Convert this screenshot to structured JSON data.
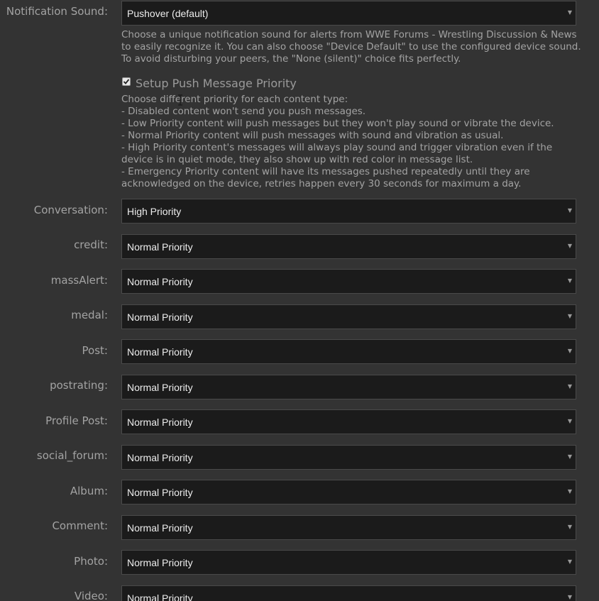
{
  "notification_sound": {
    "label": "Notification Sound:",
    "value": "Pushover (default)",
    "help_lines": [
      "Choose a unique notification sound for alerts from WWE Forums - Wrestling Discussion & News",
      "to easily recognize it. You can also choose \"Device Default\" to use the configured device sound.",
      "To avoid disturbing your peers, the \"None (silent)\" choice fits perfectly."
    ]
  },
  "priority_setup": {
    "checkbox_label": "Setup Push Message Priority",
    "checked": true,
    "help_lines": [
      "Choose different priority for each content type:",
      "- Disabled content won't send you push messages.",
      "- Low Priority content will push messages but they won't play sound or vibrate the device.",
      "- Normal Priority content will push messages with sound and vibration as usual.",
      "- High Priority content's messages will always play sound and trigger vibration even if the",
      "device is in quiet mode, they also show up with red color in message list.",
      "- Emergency Priority content will have its messages pushed repeatedly until they are",
      "acknowledged on the device, retries happen every 30 seconds for maximum a day."
    ]
  },
  "content_types": [
    {
      "label": "Conversation:",
      "value": "High Priority"
    },
    {
      "label": "credit:",
      "value": "Normal Priority"
    },
    {
      "label": "massAlert:",
      "value": "Normal Priority"
    },
    {
      "label": "medal:",
      "value": "Normal Priority"
    },
    {
      "label": "Post:",
      "value": "Normal Priority"
    },
    {
      "label": "postrating:",
      "value": "Normal Priority"
    },
    {
      "label": "Profile Post:",
      "value": "Normal Priority"
    },
    {
      "label": "social_forum:",
      "value": "Normal Priority"
    },
    {
      "label": "Album:",
      "value": "Normal Priority"
    },
    {
      "label": "Comment:",
      "value": "Normal Priority"
    },
    {
      "label": "Photo:",
      "value": "Normal Priority"
    },
    {
      "label": "Video:",
      "value": "Normal Priority"
    }
  ],
  "icons": {
    "caret": "caret-down-icon",
    "checkbox": "checkmark-icon",
    "cursor": "text-cursor-icon"
  },
  "colors": {
    "background": "#333333",
    "select_background": "#1b1b1b",
    "text_muted": "#a3a3a3",
    "text_value": "#ededed"
  }
}
